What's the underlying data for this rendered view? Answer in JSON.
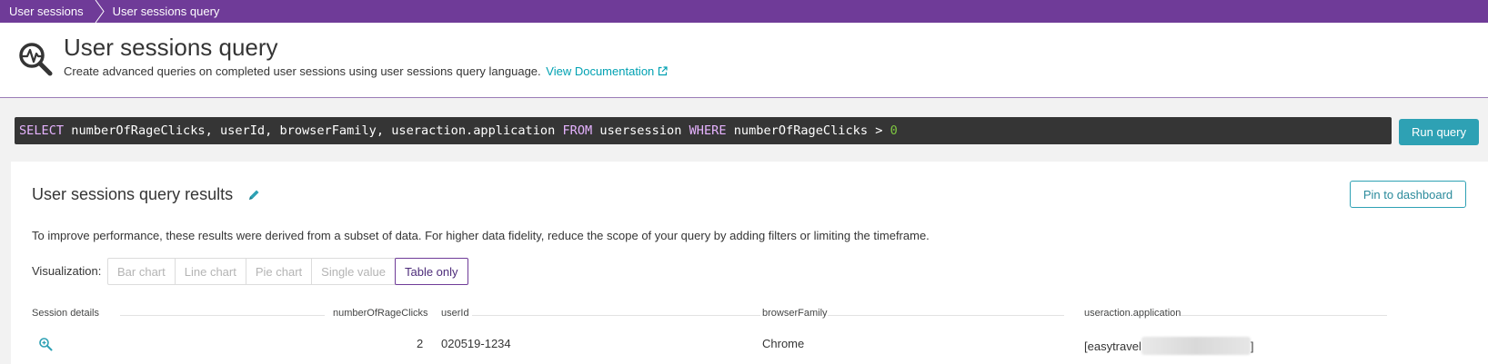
{
  "breadcrumb": {
    "items": [
      "User sessions",
      "User sessions query"
    ]
  },
  "header": {
    "title": "User sessions query",
    "subtitle": "Create advanced queries on completed user sessions using user sessions query language.",
    "doc_link": "View Documentation"
  },
  "query": {
    "tokens": [
      {
        "text": "SELECT",
        "kind": "keyword"
      },
      {
        "text": " numberOfRageClicks, userId, browserFamily, useraction.application ",
        "kind": "plain"
      },
      {
        "text": "FROM",
        "kind": "keyword"
      },
      {
        "text": " usersession ",
        "kind": "plain"
      },
      {
        "text": "WHERE",
        "kind": "keyword"
      },
      {
        "text": " numberOfRageClicks > ",
        "kind": "plain"
      },
      {
        "text": "0",
        "kind": "number"
      }
    ],
    "run_label": "Run query"
  },
  "results": {
    "title": "User sessions query results",
    "pin_label": "Pin to dashboard",
    "note": "To improve performance, these results were derived from a subset of data. For higher data fidelity, reduce the scope of your query by adding filters or limiting the timeframe.",
    "viz_label": "Visualization:",
    "viz_options": [
      "Bar chart",
      "Line chart",
      "Pie chart",
      "Single value",
      "Table only"
    ],
    "viz_selected": "Table only"
  },
  "table": {
    "columns": [
      "Session details",
      "numberOfRageClicks",
      "userId",
      "browserFamily",
      "useraction.application"
    ],
    "rows": [
      {
        "numberOfRageClicks": "2",
        "userId": "020519-1234",
        "browserFamily": "Chrome",
        "app_prefix": "[easytravel",
        "app_suffix": "]"
      }
    ]
  },
  "colors": {
    "brand_purple": "#6f3b98",
    "accent_teal": "#2ea1b4",
    "query_bg": "#353535",
    "keyword": "#e6b3ff",
    "number": "#7dc540"
  },
  "icons": {
    "header": "session-query-icon",
    "external": "external-link-icon",
    "edit": "pencil-icon",
    "row_detail": "zoom-in-icon"
  }
}
